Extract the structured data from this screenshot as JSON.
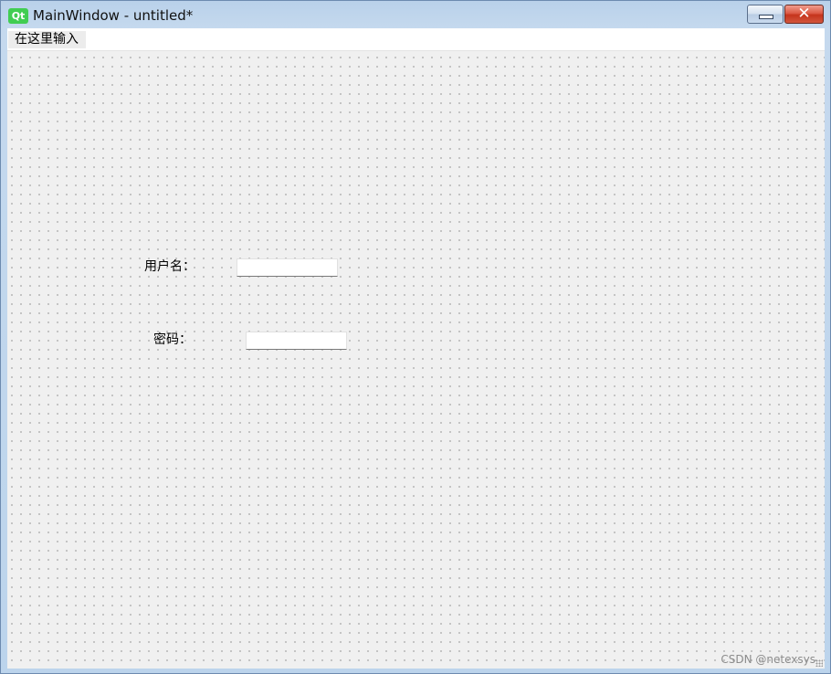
{
  "window": {
    "app_icon_text": "Qt",
    "title": "MainWindow - untitled*",
    "minimize_icon": "minimize-icon",
    "close_icon": "close-icon",
    "close_glyph": "✕"
  },
  "menubar": {
    "items": [
      {
        "label": "在这里输入"
      }
    ]
  },
  "form": {
    "username_label": "用户名：",
    "username_value": "",
    "password_label": "密码：",
    "password_value": ""
  },
  "watermark": "CSDN @netexsys",
  "colors": {
    "qt_brand": "#41cd52",
    "close_button": "#c5341c",
    "title_bar": "#b9d1ea",
    "canvas": "#f0f0f0"
  }
}
